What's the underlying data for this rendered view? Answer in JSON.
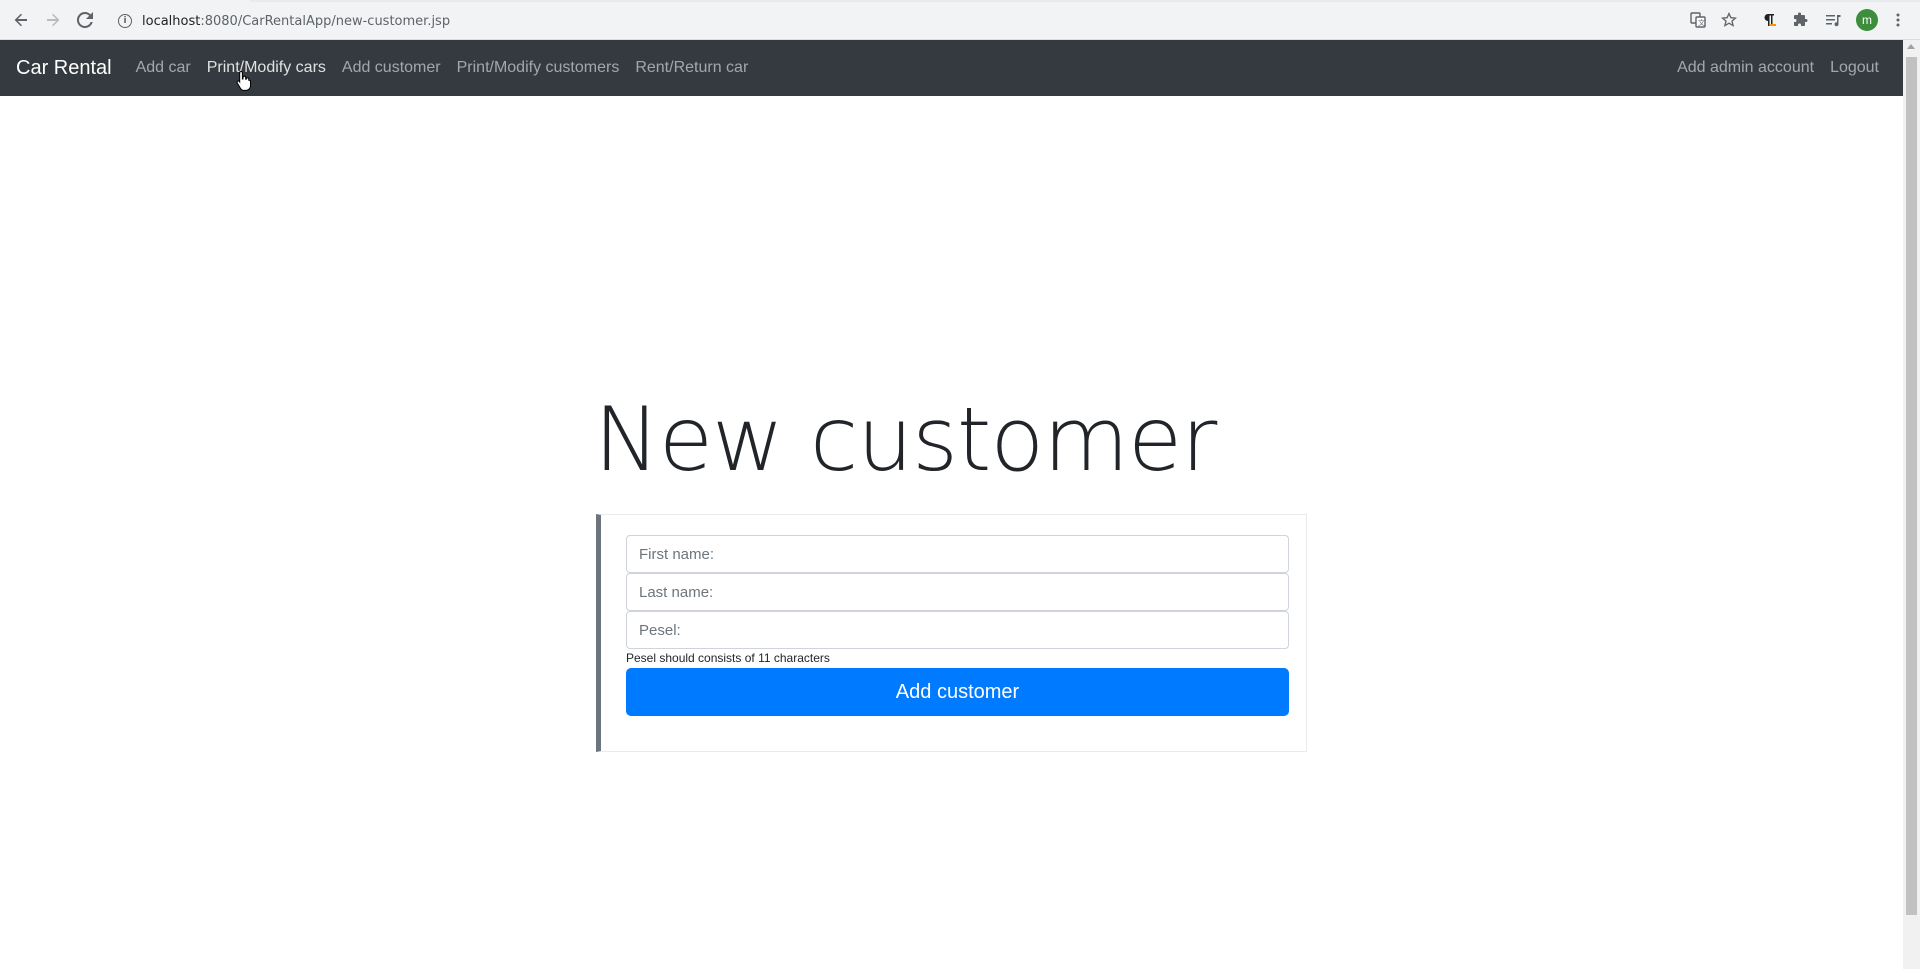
{
  "browser": {
    "url_host": "localhost",
    "url_rest": ":8080/CarRentalApp/new-customer.jsp",
    "profile_initial": "m",
    "icons": [
      "back-arrow-icon",
      "forward-arrow-icon",
      "reload-icon",
      "info-icon",
      "translate-icon",
      "star-icon",
      "pilcrow-icon",
      "extensions-puzzle-icon",
      "media-queue-icon",
      "kebab-menu-icon"
    ]
  },
  "navbar": {
    "brand": "Car Rental",
    "links": [
      {
        "label": "Add car"
      },
      {
        "label": "Print/Modify cars"
      },
      {
        "label": "Add customer"
      },
      {
        "label": "Print/Modify customers"
      },
      {
        "label": "Rent/Return car"
      }
    ],
    "right_links": [
      {
        "label": "Add admin account"
      },
      {
        "label": "Logout"
      }
    ]
  },
  "page": {
    "title": "New customer"
  },
  "form": {
    "first_name_placeholder": "First name:",
    "last_name_placeholder": "Last name:",
    "pesel_placeholder": "Pesel:",
    "pesel_hint": "Pesel should consists of 11 characters",
    "submit_label": "Add customer"
  },
  "colors": {
    "navbar_bg": "#343a40",
    "primary": "#007bff",
    "card_border_accent": "#6c757d"
  }
}
